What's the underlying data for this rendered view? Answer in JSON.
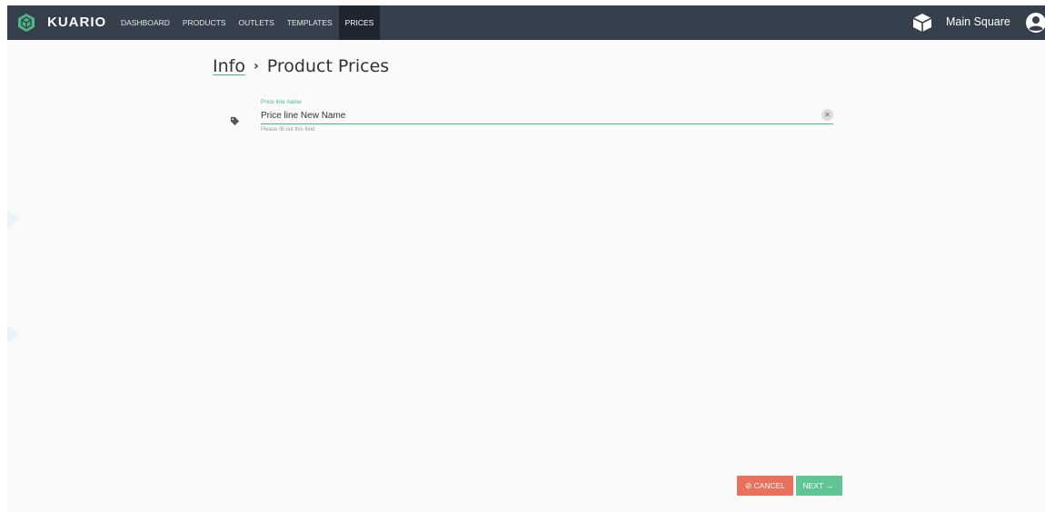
{
  "app": {
    "brand": "KUARIO",
    "brand_color": "#4db884",
    "topbar_color": "#363f4c"
  },
  "nav": {
    "items": [
      {
        "label": "DASHBOARD",
        "active": false
      },
      {
        "label": "PRODUCTS",
        "active": false
      },
      {
        "label": "OUTLETS",
        "active": false
      },
      {
        "label": "TEMPLATES",
        "active": false
      },
      {
        "label": "PRICES",
        "active": true
      }
    ]
  },
  "store": {
    "name": "Main Square",
    "icon": "cube-icon"
  },
  "user": {
    "icon": "user-circle-icon"
  },
  "breadcrumb": {
    "link": "Info",
    "separator": "›",
    "current": "Product Prices"
  },
  "form": {
    "price_line": {
      "icon": "tag-icon",
      "label": "Price line name",
      "value": "Price line New Name",
      "hint": "Please fill out this field",
      "clear_glyph": "✕"
    }
  },
  "actions": {
    "cancel_glyph": "⊘",
    "cancel_label": "CANCEL",
    "next_label": "NEXT",
    "next_glyph": "→",
    "cancel_color": "#e9705a",
    "next_color": "#5fc595"
  }
}
